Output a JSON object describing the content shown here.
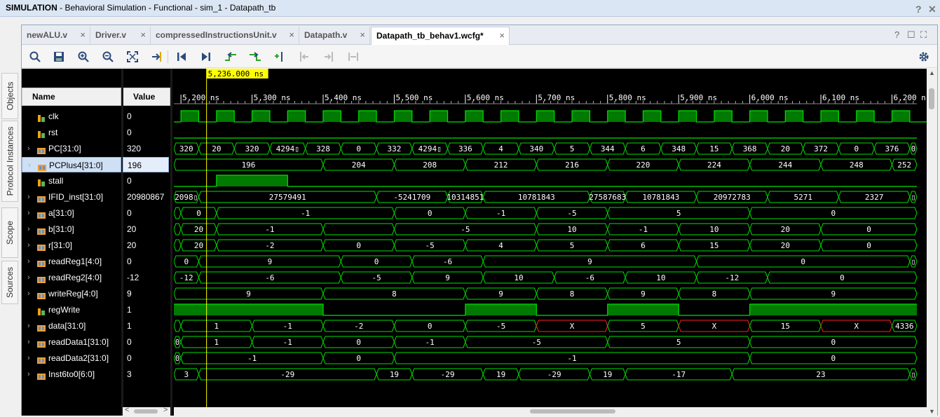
{
  "window": {
    "title_prefix": "SIMULATION",
    "title_rest": " - Behavioral Simulation - Functional - sim_1 - Datapath_tb",
    "help": "?",
    "close": "✕"
  },
  "sidebar": {
    "tabs": [
      "Objects",
      "Protocol Instances",
      "Scope",
      "Sources"
    ]
  },
  "tabs": [
    {
      "label": "newALU.v",
      "active": false
    },
    {
      "label": "Driver.v",
      "active": false
    },
    {
      "label": "compressedInstructionsUnit.v",
      "active": false
    },
    {
      "label": "Datapath.v",
      "active": false
    },
    {
      "label": "Datapath_tb_behav1.wcfg*",
      "active": true
    }
  ],
  "tab_controls": {
    "help": "?",
    "restore": "☐",
    "maximize": "⛶"
  },
  "toolbar": {
    "icons": [
      "search-icon",
      "save-icon",
      "zoom-in-icon",
      "zoom-out-icon",
      "zoom-fit-icon",
      "go-to-cursor-icon",
      "go-to-time-0-icon",
      "go-to-last-time-icon",
      "previous-transition-icon",
      "next-transition-icon",
      "add-marker-icon",
      "previous-marker-icon",
      "next-marker-icon",
      "swap-cursors-icon"
    ],
    "settings_icon": "gear-icon"
  },
  "columns": {
    "name": "Name",
    "value": "Value"
  },
  "cursor": {
    "label": "5,236.000 ns",
    "time": 5236
  },
  "timeline": {
    "start": 5190,
    "end": 6235,
    "ticks": [
      {
        "t": 5200,
        "label": "5,200 ns"
      },
      {
        "t": 5300,
        "label": "5,300 ns"
      },
      {
        "t": 5400,
        "label": "5,400 ns"
      },
      {
        "t": 5500,
        "label": "5,500 ns"
      },
      {
        "t": 5600,
        "label": "5,600 ns"
      },
      {
        "t": 5700,
        "label": "5,700 ns"
      },
      {
        "t": 5800,
        "label": "5,800 ns"
      },
      {
        "t": 5900,
        "label": "5,900 ns"
      },
      {
        "t": 6000,
        "label": "6,000 ns"
      },
      {
        "t": 6100,
        "label": "6,100 ns"
      },
      {
        "t": 6200,
        "label": "6,200 ns"
      }
    ]
  },
  "colors": {
    "wave": "#00e000",
    "wave_fill": "#007a00",
    "unknown": "#ff2020",
    "cursor": "#ffff00",
    "bg": "#000000"
  },
  "signals": [
    {
      "name": "clk",
      "value": "0",
      "kind": "clock",
      "icon": "bit-icon",
      "expandable": false
    },
    {
      "name": "rst",
      "value": "0",
      "kind": "bit",
      "icon": "bit-icon",
      "expandable": false,
      "segments": [
        {
          "s": 5190,
          "e": 6235,
          "v": "0"
        }
      ]
    },
    {
      "name": "PC[31:0]",
      "value": "320",
      "kind": "bus",
      "icon": "bus-icon",
      "expandable": true,
      "segments": [
        {
          "s": 5190,
          "e": 5225,
          "v": "320"
        },
        {
          "s": 5225,
          "e": 5275,
          "v": "20"
        },
        {
          "s": 5275,
          "e": 5325,
          "v": "320"
        },
        {
          "s": 5325,
          "e": 5375,
          "v": "4294▯"
        },
        {
          "s": 5375,
          "e": 5425,
          "v": "328"
        },
        {
          "s": 5425,
          "e": 5475,
          "v": "0"
        },
        {
          "s": 5475,
          "e": 5525,
          "v": "332"
        },
        {
          "s": 5525,
          "e": 5575,
          "v": "4294▯"
        },
        {
          "s": 5575,
          "e": 5625,
          "v": "336"
        },
        {
          "s": 5625,
          "e": 5675,
          "v": "4"
        },
        {
          "s": 5675,
          "e": 5725,
          "v": "340"
        },
        {
          "s": 5725,
          "e": 5775,
          "v": "5"
        },
        {
          "s": 5775,
          "e": 5825,
          "v": "344"
        },
        {
          "s": 5825,
          "e": 5875,
          "v": "6"
        },
        {
          "s": 5875,
          "e": 5925,
          "v": "348"
        },
        {
          "s": 5925,
          "e": 5975,
          "v": "15"
        },
        {
          "s": 5975,
          "e": 6025,
          "v": "368"
        },
        {
          "s": 6025,
          "e": 6075,
          "v": "20"
        },
        {
          "s": 6075,
          "e": 6125,
          "v": "372"
        },
        {
          "s": 6125,
          "e": 6175,
          "v": "0"
        },
        {
          "s": 6175,
          "e": 6225,
          "v": "376"
        },
        {
          "s": 6225,
          "e": 6235,
          "v": "0"
        }
      ]
    },
    {
      "name": "PCPlus4[31:0]",
      "value": "196",
      "kind": "bus",
      "icon": "bus-icon",
      "expandable": true,
      "selected": true,
      "segments": [
        {
          "s": 5190,
          "e": 5400,
          "v": "196"
        },
        {
          "s": 5400,
          "e": 5500,
          "v": "204"
        },
        {
          "s": 5500,
          "e": 5600,
          "v": "208"
        },
        {
          "s": 5600,
          "e": 5700,
          "v": "212"
        },
        {
          "s": 5700,
          "e": 5800,
          "v": "216"
        },
        {
          "s": 5800,
          "e": 5900,
          "v": "220"
        },
        {
          "s": 5900,
          "e": 6000,
          "v": "224"
        },
        {
          "s": 6000,
          "e": 6100,
          "v": "244"
        },
        {
          "s": 6100,
          "e": 6200,
          "v": "248"
        },
        {
          "s": 6200,
          "e": 6235,
          "v": "252"
        }
      ]
    },
    {
      "name": "stall",
      "value": "0",
      "kind": "bit",
      "icon": "bit-icon",
      "expandable": false,
      "segments": [
        {
          "s": 5190,
          "e": 5250,
          "v": "0"
        },
        {
          "s": 5250,
          "e": 5350,
          "v": "1"
        },
        {
          "s": 5350,
          "e": 6235,
          "v": "0"
        }
      ]
    },
    {
      "name": "IFID_inst[31:0]",
      "value": "20980867",
      "kind": "bus",
      "icon": "bus-icon",
      "expandable": true,
      "segments": [
        {
          "s": 5190,
          "e": 5225,
          "v": "2098▯"
        },
        {
          "s": 5225,
          "e": 5475,
          "v": "27579491"
        },
        {
          "s": 5475,
          "e": 5575,
          "v": "-5241709"
        },
        {
          "s": 5575,
          "e": 5625,
          "v": "10314851"
        },
        {
          "s": 5625,
          "e": 5775,
          "v": "10781843"
        },
        {
          "s": 5775,
          "e": 5825,
          "v": "27587683"
        },
        {
          "s": 5825,
          "e": 5925,
          "v": "10781843"
        },
        {
          "s": 5925,
          "e": 6025,
          "v": "20972783"
        },
        {
          "s": 6025,
          "e": 6125,
          "v": "5271"
        },
        {
          "s": 6125,
          "e": 6225,
          "v": "2327"
        },
        {
          "s": 6225,
          "e": 6235,
          "v": "▯"
        }
      ]
    },
    {
      "name": "a[31:0]",
      "value": "0",
      "kind": "bus",
      "icon": "bus-icon",
      "expandable": true,
      "segments": [
        {
          "s": 5190,
          "e": 5200,
          "v": ""
        },
        {
          "s": 5200,
          "e": 5250,
          "v": "0"
        },
        {
          "s": 5250,
          "e": 5500,
          "v": "-1"
        },
        {
          "s": 5500,
          "e": 5600,
          "v": "0"
        },
        {
          "s": 5600,
          "e": 5700,
          "v": "-1"
        },
        {
          "s": 5700,
          "e": 5800,
          "v": "-5"
        },
        {
          "s": 5800,
          "e": 6000,
          "v": "5"
        },
        {
          "s": 6000,
          "e": 6235,
          "v": "0"
        }
      ]
    },
    {
      "name": "b[31:0]",
      "value": "20",
      "kind": "bus",
      "icon": "bus-icon",
      "expandable": true,
      "segments": [
        {
          "s": 5190,
          "e": 5200,
          "v": ""
        },
        {
          "s": 5200,
          "e": 5250,
          "v": "20"
        },
        {
          "s": 5250,
          "e": 5400,
          "v": "-1"
        },
        {
          "s": 5400,
          "e": 5500,
          "v": ""
        },
        {
          "s": 5500,
          "e": 5700,
          "v": "-5"
        },
        {
          "s": 5700,
          "e": 5800,
          "v": "10"
        },
        {
          "s": 5800,
          "e": 5900,
          "v": "-1"
        },
        {
          "s": 5900,
          "e": 6000,
          "v": "10"
        },
        {
          "s": 6000,
          "e": 6100,
          "v": "20"
        },
        {
          "s": 6100,
          "e": 6235,
          "v": "0"
        }
      ]
    },
    {
      "name": "r[31:0]",
      "value": "20",
      "kind": "bus",
      "icon": "bus-icon",
      "expandable": true,
      "segments": [
        {
          "s": 5190,
          "e": 5200,
          "v": ""
        },
        {
          "s": 5200,
          "e": 5250,
          "v": "20"
        },
        {
          "s": 5250,
          "e": 5400,
          "v": "-2"
        },
        {
          "s": 5400,
          "e": 5500,
          "v": "0"
        },
        {
          "s": 5500,
          "e": 5600,
          "v": "-5"
        },
        {
          "s": 5600,
          "e": 5700,
          "v": "4"
        },
        {
          "s": 5700,
          "e": 5800,
          "v": "5"
        },
        {
          "s": 5800,
          "e": 5900,
          "v": "6"
        },
        {
          "s": 5900,
          "e": 6000,
          "v": "15"
        },
        {
          "s": 6000,
          "e": 6100,
          "v": "20"
        },
        {
          "s": 6100,
          "e": 6235,
          "v": "0"
        }
      ]
    },
    {
      "name": "readReg1[4:0]",
      "value": "0",
      "kind": "bus",
      "icon": "bus-icon",
      "expandable": true,
      "segments": [
        {
          "s": 5190,
          "e": 5225,
          "v": "0"
        },
        {
          "s": 5225,
          "e": 5425,
          "v": "9"
        },
        {
          "s": 5425,
          "e": 5525,
          "v": "0"
        },
        {
          "s": 5525,
          "e": 5625,
          "v": "-6"
        },
        {
          "s": 5625,
          "e": 5925,
          "v": "9"
        },
        {
          "s": 5925,
          "e": 6225,
          "v": "0"
        },
        {
          "s": 6225,
          "e": 6235,
          "v": "▯"
        }
      ]
    },
    {
      "name": "readReg2[4:0]",
      "value": "-12",
      "kind": "bus",
      "icon": "bus-icon",
      "expandable": true,
      "segments": [
        {
          "s": 5190,
          "e": 5225,
          "v": "-12"
        },
        {
          "s": 5225,
          "e": 5425,
          "v": "-6"
        },
        {
          "s": 5425,
          "e": 5525,
          "v": "-5"
        },
        {
          "s": 5525,
          "e": 5625,
          "v": "9"
        },
        {
          "s": 5625,
          "e": 5725,
          "v": "10"
        },
        {
          "s": 5725,
          "e": 5825,
          "v": "-6"
        },
        {
          "s": 5825,
          "e": 5925,
          "v": "10"
        },
        {
          "s": 5925,
          "e": 6025,
          "v": "-12"
        },
        {
          "s": 6025,
          "e": 6235,
          "v": "0"
        }
      ]
    },
    {
      "name": "writeReg[4:0]",
      "value": "9",
      "kind": "bus",
      "icon": "bus-icon",
      "expandable": true,
      "segments": [
        {
          "s": 5190,
          "e": 5400,
          "v": "9"
        },
        {
          "s": 5400,
          "e": 5600,
          "v": "8"
        },
        {
          "s": 5600,
          "e": 5700,
          "v": "9"
        },
        {
          "s": 5700,
          "e": 5800,
          "v": "8"
        },
        {
          "s": 5800,
          "e": 5900,
          "v": "9"
        },
        {
          "s": 5900,
          "e": 6000,
          "v": "8"
        },
        {
          "s": 6000,
          "e": 6235,
          "v": "9"
        }
      ]
    },
    {
      "name": "regWrite",
      "value": "1",
      "kind": "bit",
      "icon": "bit-icon",
      "expandable": false,
      "segments": [
        {
          "s": 5190,
          "e": 5400,
          "v": "1"
        },
        {
          "s": 5400,
          "e": 5600,
          "v": "0"
        },
        {
          "s": 5600,
          "e": 5700,
          "v": "1"
        },
        {
          "s": 5700,
          "e": 5800,
          "v": "0"
        },
        {
          "s": 5800,
          "e": 5900,
          "v": "1"
        },
        {
          "s": 5900,
          "e": 6000,
          "v": "0"
        },
        {
          "s": 6000,
          "e": 6235,
          "v": "1"
        }
      ]
    },
    {
      "name": "data[31:0]",
      "value": "1",
      "kind": "bus",
      "icon": "bus-icon",
      "expandable": true,
      "segments": [
        {
          "s": 5190,
          "e": 5200,
          "v": ""
        },
        {
          "s": 5200,
          "e": 5300,
          "v": "1"
        },
        {
          "s": 5300,
          "e": 5400,
          "v": "-1"
        },
        {
          "s": 5400,
          "e": 5500,
          "v": "-2"
        },
        {
          "s": 5500,
          "e": 5600,
          "v": "0"
        },
        {
          "s": 5600,
          "e": 5700,
          "v": "-5"
        },
        {
          "s": 5700,
          "e": 5800,
          "v": "X",
          "x": true
        },
        {
          "s": 5800,
          "e": 5900,
          "v": "5"
        },
        {
          "s": 5900,
          "e": 6000,
          "v": "X",
          "x": true
        },
        {
          "s": 6000,
          "e": 6100,
          "v": "15"
        },
        {
          "s": 6100,
          "e": 6200,
          "v": "X",
          "x": true
        },
        {
          "s": 6200,
          "e": 6235,
          "v": "4336"
        }
      ]
    },
    {
      "name": "readData1[31:0]",
      "value": "0",
      "kind": "bus",
      "icon": "bus-icon",
      "expandable": true,
      "segments": [
        {
          "s": 5190,
          "e": 5200,
          "v": "0"
        },
        {
          "s": 5200,
          "e": 5300,
          "v": "1"
        },
        {
          "s": 5300,
          "e": 5400,
          "v": "-1"
        },
        {
          "s": 5400,
          "e": 5500,
          "v": "0"
        },
        {
          "s": 5500,
          "e": 5600,
          "v": "-1"
        },
        {
          "s": 5600,
          "e": 5800,
          "v": "-5"
        },
        {
          "s": 5800,
          "e": 6000,
          "v": "5"
        },
        {
          "s": 6000,
          "e": 6235,
          "v": "0"
        }
      ]
    },
    {
      "name": "readData2[31:0]",
      "value": "0",
      "kind": "bus",
      "icon": "bus-icon",
      "expandable": true,
      "segments": [
        {
          "s": 5190,
          "e": 5200,
          "v": "0"
        },
        {
          "s": 5200,
          "e": 5400,
          "v": "-1"
        },
        {
          "s": 5400,
          "e": 5500,
          "v": "0"
        },
        {
          "s": 5500,
          "e": 6000,
          "v": "-1"
        },
        {
          "s": 6000,
          "e": 6235,
          "v": "0"
        }
      ]
    },
    {
      "name": "Inst6to0[6:0]",
      "value": "3",
      "kind": "bus",
      "icon": "bus-icon",
      "expandable": true,
      "segments": [
        {
          "s": 5190,
          "e": 5225,
          "v": "3"
        },
        {
          "s": 5225,
          "e": 5475,
          "v": "-29"
        },
        {
          "s": 5475,
          "e": 5525,
          "v": "19"
        },
        {
          "s": 5525,
          "e": 5625,
          "v": "-29"
        },
        {
          "s": 5625,
          "e": 5675,
          "v": "19"
        },
        {
          "s": 5675,
          "e": 5775,
          "v": "-29"
        },
        {
          "s": 5775,
          "e": 5825,
          "v": "19"
        },
        {
          "s": 5825,
          "e": 5975,
          "v": "-17"
        },
        {
          "s": 5975,
          "e": 6225,
          "v": "23"
        },
        {
          "s": 6225,
          "e": 6235,
          "v": "▯"
        }
      ]
    }
  ]
}
